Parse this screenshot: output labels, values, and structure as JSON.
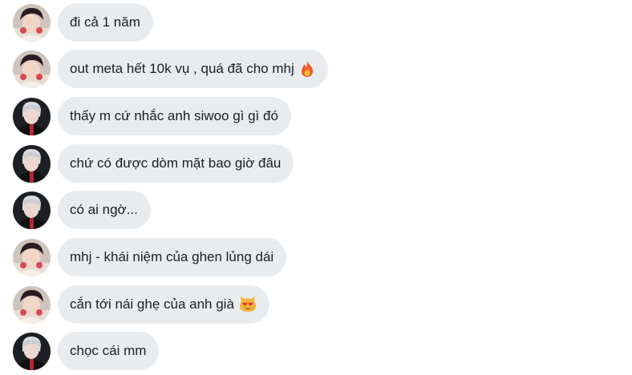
{
  "conversation": {
    "messages": [
      {
        "sender": "a",
        "text": "đi cả 1 năm"
      },
      {
        "sender": "a",
        "text": "out meta hết 10k vụ , quá đã cho mhj",
        "emoji": "fire-emoji"
      },
      {
        "sender": "b",
        "text": "thấy m cứ nhắc anh siwoo gì gì đó"
      },
      {
        "sender": "b",
        "text": "chứ có được dòm mặt bao giờ đâu"
      },
      {
        "sender": "b",
        "text": "có ai ngờ..."
      },
      {
        "sender": "a",
        "text": "mhj - khái niệm của ghen lủng dái"
      },
      {
        "sender": "a",
        "text": "cắn tới nái ghẹ của anh già",
        "emoji": "heart-eyes-cat-emoji"
      },
      {
        "sender": "b",
        "text": "chọc cái mm"
      }
    ]
  }
}
